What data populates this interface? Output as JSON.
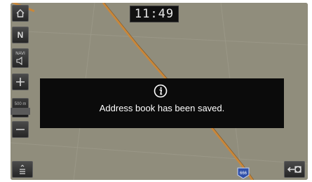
{
  "status": {
    "time": "11:49"
  },
  "sidebar": {
    "north_label": "N",
    "volume_label": "NAVI",
    "scale_label": "500 m"
  },
  "dialog": {
    "icon": "info-icon",
    "message": "Address book has been saved."
  },
  "map": {
    "road_label": "666"
  },
  "colors": {
    "map_background": "#8f8c7c",
    "road": "#c9873a",
    "dialog_background": "#0b0b0b",
    "button_background": "#333333"
  }
}
